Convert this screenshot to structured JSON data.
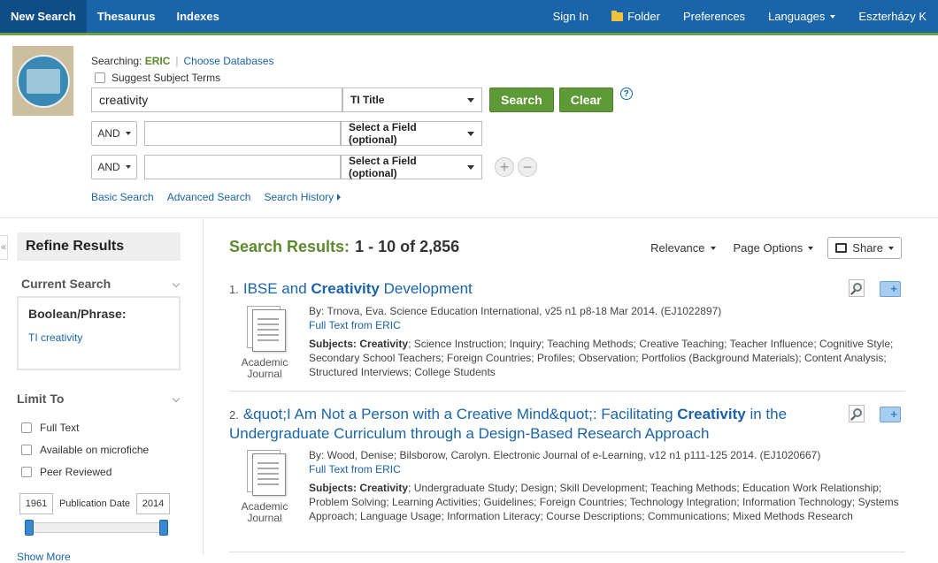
{
  "topbar": {
    "tabs": [
      "New Search",
      "Thesaurus",
      "Indexes"
    ],
    "sign_in": "Sign In",
    "folder": "Folder",
    "preferences": "Preferences",
    "languages": "Languages",
    "account": "Eszterházy K"
  },
  "search": {
    "searching_label": "Searching:",
    "database": "ERIC",
    "choose_databases": "Choose Databases",
    "suggest_terms": "Suggest Subject Terms",
    "query": "creativity",
    "field1": "TI Title",
    "search_btn": "Search",
    "clear_btn": "Clear",
    "help": "?",
    "rows": [
      {
        "op": "AND",
        "value": "",
        "field": "Select a Field (optional)"
      },
      {
        "op": "AND",
        "value": "",
        "field": "Select a Field (optional)"
      }
    ],
    "add": "+",
    "remove": "−",
    "links": [
      "Basic Search",
      "Advanced Search",
      "Search History"
    ]
  },
  "refine": {
    "title": "Refine Results",
    "current_search_heading": "Current Search",
    "boolean_label": "Boolean/Phrase:",
    "boolean_value": "TI creativity",
    "limit_heading": "Limit To",
    "limits": [
      "Full Text",
      "Available on microfiche",
      "Peer Reviewed"
    ],
    "date_from": "1961",
    "date_label": "Publication Date",
    "date_to": "2014",
    "show_more": "Show More"
  },
  "results": {
    "label": "Search Results:",
    "count": "1 - 10 of 2,856",
    "sort": "Relevance",
    "page_options": "Page Options",
    "share": "Share",
    "items": [
      {
        "num": "1.",
        "title_pre": "IBSE and ",
        "title_bold": "Creativity",
        "title_post": " Development",
        "byline": "By: Trnova, Eva. Science Education International, v25 n1 p8-18 Mar 2014. (EJ1022897)",
        "fulltext": "Full Text from ERIC",
        "subjects_label": "Subjects:",
        "subjects_bold": "Creativity",
        "subjects_rest": "; Science Instruction; Inquiry; Teaching Methods; Creative Teaching; Teacher Influence; Cognitive Style; Secondary School Teachers; Foreign Countries; Profiles; Observation; Portfolios (Background Materials); Content Analysis; Structured Interviews; College Students",
        "doc_type_1": "Academic",
        "doc_type_2": "Journal"
      },
      {
        "num": "2.",
        "title_pre": "&quot;I Am Not a Person with a Creative Mind&quot;: Facilitating ",
        "title_bold": "Creativity",
        "title_post": " in the Undergraduate Curriculum through a Design-Based Research Approach",
        "byline": "By: Wood, Denise; Bilsborow, Carolyn. Electronic Journal of e-Learning, v12 n1 p111-125 2014. (EJ1020667)",
        "fulltext": "Full Text from ERIC",
        "subjects_label": "Subjects:",
        "subjects_bold": "Creativity",
        "subjects_rest": "; Undergraduate Study; Design; Skill Development; Teaching Methods; Education Work Relationship; Problem Solving; Learning Activities; Guidelines; Foreign Countries; Technology Integration; Information Technology; Systems Approach; Language Usage; Information Literacy; Course Descriptions; Communications; Mixed Methods Research",
        "doc_type_1": "Academic",
        "doc_type_2": "Journal"
      }
    ]
  }
}
